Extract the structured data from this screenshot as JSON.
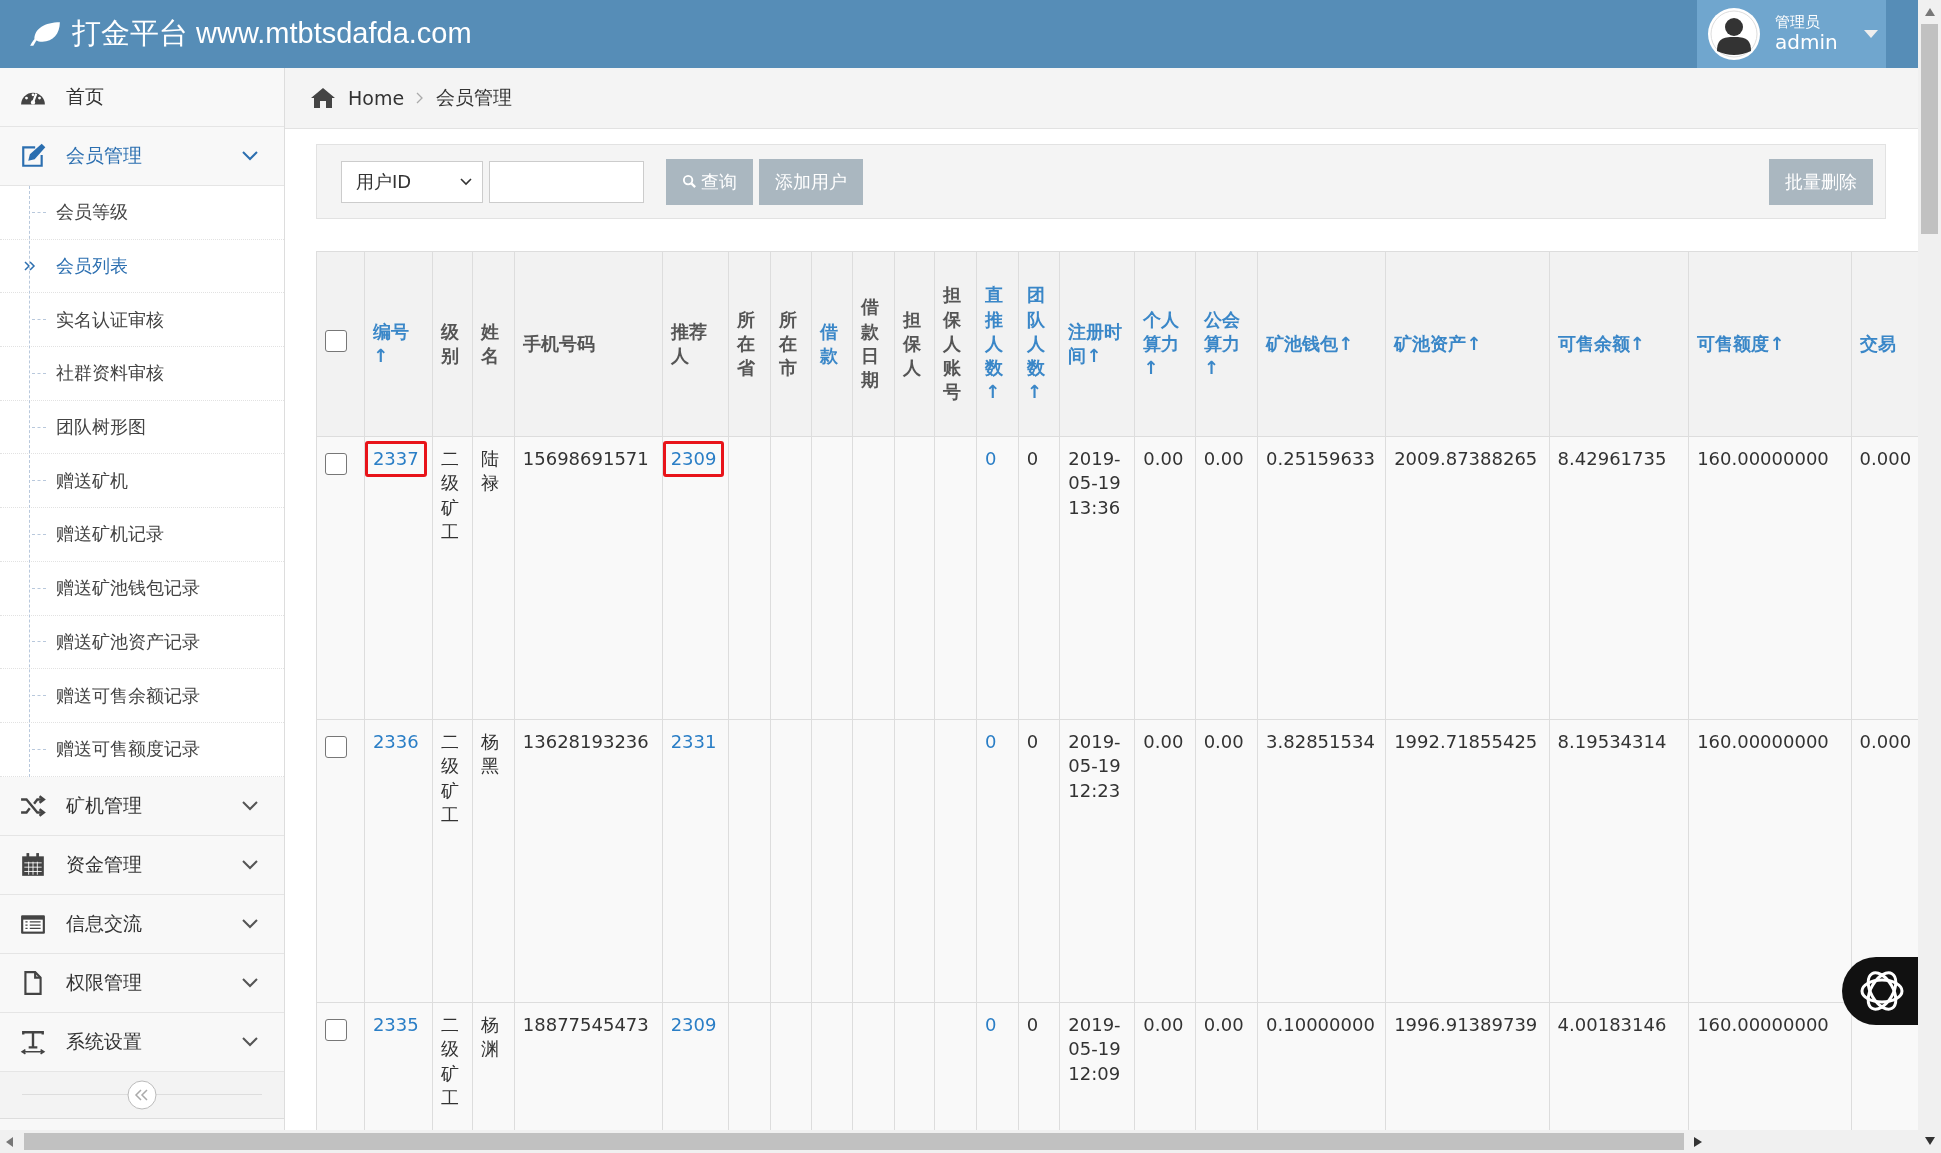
{
  "header": {
    "brand": "打金平台 www.mtbtsdafda.com",
    "user": {
      "role": "管理员",
      "name": "admin"
    }
  },
  "sidebar": {
    "items": [
      {
        "label": "首页",
        "kind": "link",
        "selected": false
      },
      {
        "label": "会员管理",
        "kind": "menu",
        "selected": true,
        "children": [
          {
            "label": "会员等级",
            "selected": false
          },
          {
            "label": "会员列表",
            "selected": true
          },
          {
            "label": "实名认证审核",
            "selected": false
          },
          {
            "label": "社群资料审核",
            "selected": false
          },
          {
            "label": "团队树形图",
            "selected": false
          },
          {
            "label": "赠送矿机",
            "selected": false
          },
          {
            "label": "赠送矿机记录",
            "selected": false
          },
          {
            "label": "赠送矿池钱包记录",
            "selected": false
          },
          {
            "label": "赠送矿池资产记录",
            "selected": false
          },
          {
            "label": "赠送可售余额记录",
            "selected": false
          },
          {
            "label": "赠送可售额度记录",
            "selected": false
          }
        ]
      },
      {
        "label": "矿机管理",
        "kind": "menu",
        "selected": false
      },
      {
        "label": "资金管理",
        "kind": "menu",
        "selected": false
      },
      {
        "label": "信息交流",
        "kind": "menu",
        "selected": false
      },
      {
        "label": "权限管理",
        "kind": "menu",
        "selected": false
      },
      {
        "label": "系统设置",
        "kind": "menu",
        "selected": false
      }
    ]
  },
  "breadcrumb": [
    "Home",
    "会员管理"
  ],
  "toolbar": {
    "filter_select": "用户ID",
    "buttons": [
      {
        "label": "查询",
        "kind": "search"
      },
      {
        "label": "添加用户",
        "kind": "plain"
      }
    ],
    "bulk_delete": "批量删除"
  },
  "table": {
    "select_all_checked": false,
    "columns": [
      {
        "label": "编号↑",
        "sortable": true
      },
      {
        "label": "级别",
        "sortable": false
      },
      {
        "label": "姓名",
        "sortable": false
      },
      {
        "label": "手机号码",
        "sortable": false
      },
      {
        "label": "推荐人",
        "sortable": false
      },
      {
        "label": "所在省",
        "sortable": false
      },
      {
        "label": "所在市",
        "sortable": false
      },
      {
        "label": "借款",
        "sortable": true
      },
      {
        "label": "借款日期",
        "sortable": false
      },
      {
        "label": "担保人",
        "sortable": false
      },
      {
        "label": "担保人账号",
        "sortable": false
      },
      {
        "label": "直推人数↑",
        "sortable": true
      },
      {
        "label": "团队人数↑",
        "sortable": true
      },
      {
        "label": "注册时间↑",
        "sortable": true
      },
      {
        "label": "个人算力↑",
        "sortable": true
      },
      {
        "label": "公会算力↑",
        "sortable": true
      },
      {
        "label": "矿池钱包↑",
        "sortable": true
      },
      {
        "label": "矿池资产↑",
        "sortable": true
      },
      {
        "label": "可售余额↑",
        "sortable": true
      },
      {
        "label": "可售额度↑",
        "sortable": true
      },
      {
        "label": "交易",
        "sortable": true
      }
    ],
    "rows": [
      {
        "checked": false,
        "cells": [
          {
            "link": "2337",
            "highlighted": true
          },
          "二级矿工",
          "陆禄",
          "15698691571",
          {
            "link": "2309",
            "highlighted": true
          },
          null,
          null,
          null,
          null,
          null,
          null,
          {
            "link": "0",
            "highlighted": false
          },
          "0",
          "2019-05-19 13:36",
          "0.00",
          "0.00",
          "0.25159633",
          "2009.87388265",
          "8.42961735",
          "160.00000000",
          "0.000"
        ]
      },
      {
        "checked": false,
        "cells": [
          {
            "link": "2336",
            "highlighted": false
          },
          "二级矿工",
          "杨黑",
          "13628193236",
          {
            "link": "2331",
            "highlighted": false
          },
          null,
          null,
          null,
          null,
          null,
          null,
          {
            "link": "0",
            "highlighted": false
          },
          "0",
          "2019-05-19 12:23",
          "0.00",
          "0.00",
          "3.82851534",
          "1992.71855425",
          "8.19534314",
          "160.00000000",
          "0.000"
        ]
      },
      {
        "checked": false,
        "cells": [
          {
            "link": "2335",
            "highlighted": false
          },
          "二级矿工",
          "杨渊",
          "18877545473",
          {
            "link": "2309",
            "highlighted": false
          },
          null,
          null,
          null,
          null,
          null,
          null,
          {
            "link": "0",
            "highlighted": false
          },
          "0",
          "2019-05-19 12:09",
          "0.00",
          "0.00",
          "0.10000000",
          "1996.91389739",
          "4.00183146",
          "160.00000000",
          null
        ]
      }
    ]
  }
}
